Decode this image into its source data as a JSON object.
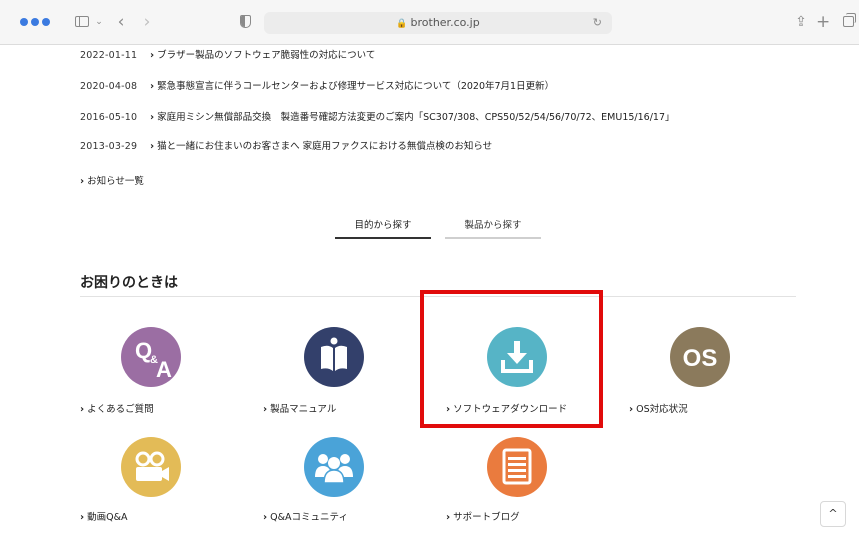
{
  "browser": {
    "address": "brother.co.jp",
    "lock_glyph": "🔒",
    "reload_glyph": "↻",
    "back_glyph": "‹",
    "forward_glyph": "›",
    "sidebar_chevron": "⌄",
    "share_glyph": "⇪",
    "new_tab_glyph": "+"
  },
  "news": [
    {
      "date": "2022-01-11",
      "title": "ブラザー製品のソフトウェア脆弱性の対応について"
    },
    {
      "date": "2020-04-08",
      "title": "緊急事態宣言に伴うコールセンターおよび修理サービス対応について（2020年7月1日更新）"
    },
    {
      "date": "2016-05-10",
      "title": "家庭用ミシン無償部品交換　製造番号確認方法変更のご案内「SC307/308、CPS50/52/54/56/70/72、EMU15/16/17」"
    },
    {
      "date": "2013-03-29",
      "title": "猫と一緒にお住まいのお客さまへ 家庭用ファクスにおける無償点検のお知らせ"
    }
  ],
  "news_more": "お知らせ一覧",
  "chevron": "›",
  "tabs": {
    "purpose": "目的から探す",
    "product": "製品から探す"
  },
  "section_title": "お困りのときは",
  "items": [
    {
      "label": "よくあるご質問",
      "icon": "qa-icon",
      "color": "#9b6ea3"
    },
    {
      "label": "製品マニュアル",
      "icon": "book-icon",
      "color": "#33406b"
    },
    {
      "label": "ソフトウェアダウンロード",
      "icon": "download-icon",
      "color": "#56b4c6"
    },
    {
      "label": "OS対応状況",
      "icon": "os-icon",
      "color": "#8b7a5c"
    },
    {
      "label": "動画Q&A",
      "icon": "video-camera-icon",
      "color": "#e3bb57"
    },
    {
      "label": "Q&Aコミュニティ",
      "icon": "community-icon",
      "color": "#4aa3d8"
    },
    {
      "label": "サポートブログ",
      "icon": "blog-icon",
      "color": "#ea7b3e"
    }
  ],
  "icon_text": {
    "qa_q": "Q",
    "qa_amp": "&",
    "qa_a": "A",
    "os": "OS"
  },
  "scroll_top_glyph": "^"
}
